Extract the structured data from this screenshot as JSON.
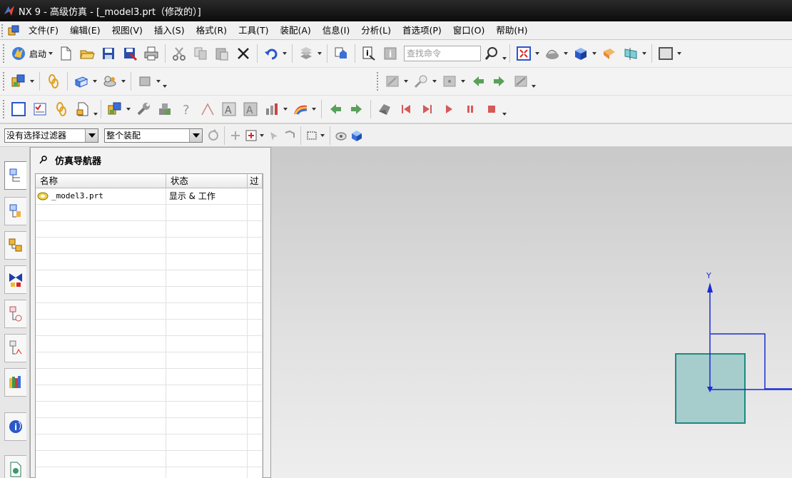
{
  "window": {
    "title": "NX 9 - 高级仿真 - [_model3.prt（修改的）]"
  },
  "menu": {
    "items": [
      {
        "label": "文件(F)"
      },
      {
        "label": "编辑(E)"
      },
      {
        "label": "视图(V)"
      },
      {
        "label": "插入(S)"
      },
      {
        "label": "格式(R)"
      },
      {
        "label": "工具(T)"
      },
      {
        "label": "装配(A)"
      },
      {
        "label": "信息(I)"
      },
      {
        "label": "分析(L)"
      },
      {
        "label": "首选项(P)"
      },
      {
        "label": "窗口(O)"
      },
      {
        "label": "帮助(H)"
      }
    ]
  },
  "toolbar": {
    "start_label": "启动",
    "search_placeholder": "查找命令"
  },
  "selection_bar": {
    "filter_value": "没有选择过滤器",
    "scope_value": "整个装配"
  },
  "navigator": {
    "title": "仿真导航器",
    "columns": [
      "名称",
      "状态",
      "过"
    ],
    "rows": [
      {
        "name": "_model3.prt",
        "status": "显示 & 工作"
      }
    ]
  },
  "graphics": {
    "axis_label": "Y"
  },
  "colors": {
    "titlebar": "#111111",
    "accent_blue": "#1a2bd6",
    "block_fill": "#a7cccc",
    "block_edge": "#1b8a80"
  }
}
